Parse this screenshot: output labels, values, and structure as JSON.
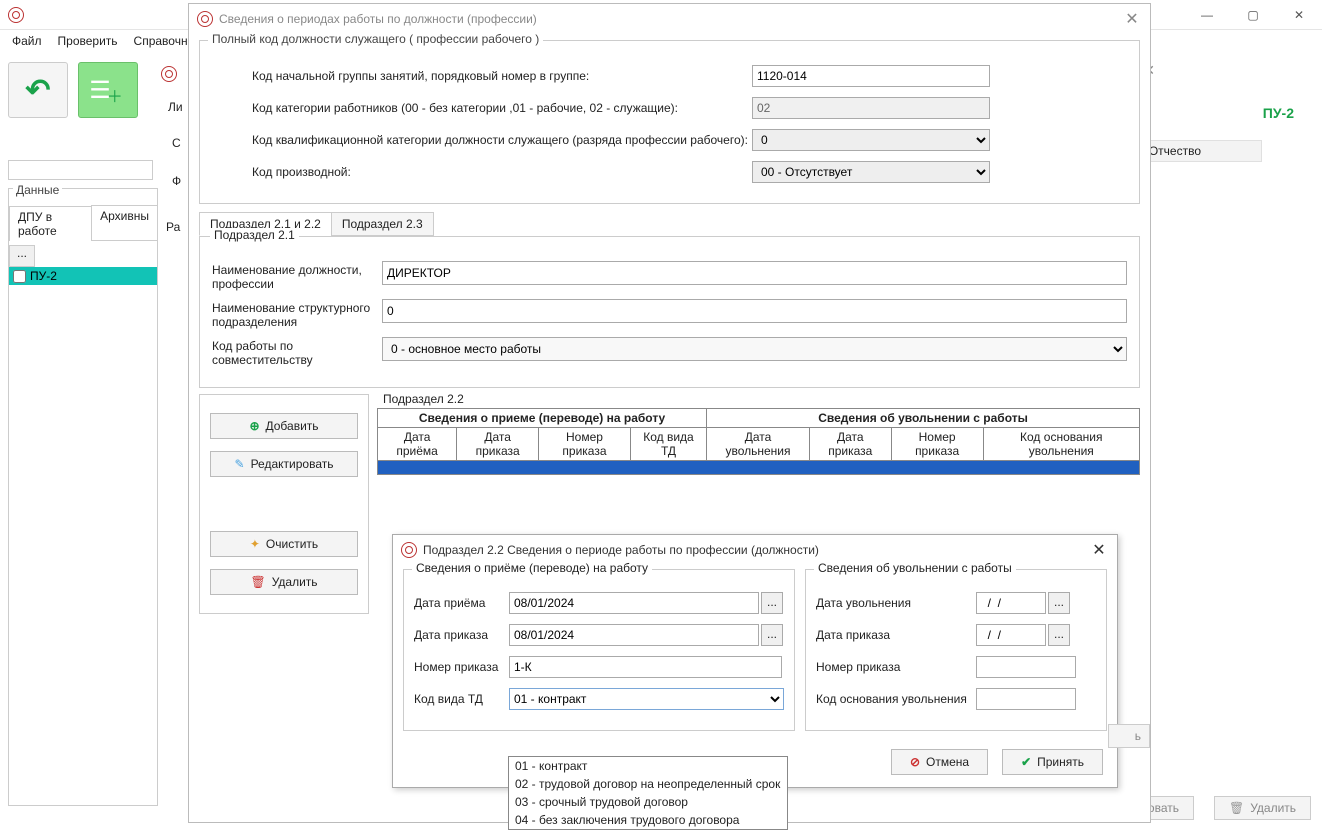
{
  "main": {
    "menu": {
      "file": "Файл",
      "check": "Проверить",
      "ref": "Справочни"
    },
    "pu2": "ПУ-2",
    "otchestvo": "Отчество",
    "data_label": "Данные",
    "tabs": {
      "active": "ДПУ в работе",
      "other": "Архивны"
    },
    "list_item": "ПУ-2",
    "bottom": {
      "edit": "тировать",
      "delete": "Удалить"
    }
  },
  "dlg1": {
    "title": "Сведения о периодах работы по должности (профессии)",
    "group_legend": "Полный код должности служащего ( профессии рабочего )",
    "rows": {
      "r1": {
        "label": "Код начальной группы занятий, порядковый номер в группе:",
        "value": "1120-014"
      },
      "r2": {
        "label": "Код категории работников (00 - без категории ,01 - рабочие, 02 - служащие):",
        "value": "02"
      },
      "r3": {
        "label": "Код квалификационной категории должности служащего (разряда профессии рабочего):",
        "value": "0"
      },
      "r4": {
        "label": "Код производной:",
        "value": "00 - Отсутствует"
      }
    },
    "tabs": {
      "t1": "Подраздел 2.1 и 2.2",
      "t2": "Подраздел 2.3"
    },
    "sub21": {
      "legend": "Подраздел 2.1",
      "r1": {
        "label": "Наименование должности, профессии",
        "value": "ДИРЕКТОР"
      },
      "r2": {
        "label": "Наименование структурного подразделения",
        "value": "0"
      },
      "r3": {
        "label": "Код работы по совместительству",
        "value": "0 - основное место работы"
      }
    },
    "actions": {
      "add": "Добавить",
      "edit": "Редактировать",
      "clear": "Очистить",
      "delete": "Удалить"
    },
    "sub22": {
      "legend": "Подраздел 2.2",
      "h_left": "Сведения о приеме (переводе) на работу",
      "h_right": "Сведения об увольнении с работы",
      "cols": {
        "c1": "Дата приёма",
        "c2": "Дата приказа",
        "c3": "Номер приказа",
        "c4": "Код вида ТД",
        "c5": "Дата увольнения",
        "c6": "Дата приказа",
        "c7": "Номер приказа",
        "c8": "Код основания увольнения"
      }
    }
  },
  "dlg2": {
    "title": "Подраздел 2.2 Сведения о периоде работы по профессии (должности)",
    "left_legend": "Сведения о приёме (переводе) на работу",
    "right_legend": "Сведения об увольнении с работы",
    "left": {
      "date_in": {
        "label": "Дата приёма",
        "value": "08/01/2024"
      },
      "date_ord": {
        "label": "Дата приказа",
        "value": "08/01/2024"
      },
      "num_ord": {
        "label": "Номер приказа",
        "value": "1-К"
      },
      "td_code": {
        "label": "Код вида ТД",
        "value": "01 - контракт"
      }
    },
    "right": {
      "date_out": {
        "label": "Дата увольнения",
        "value": "  /  /"
      },
      "date_ord": {
        "label": "Дата приказа",
        "value": "  /  /"
      },
      "num_ord": {
        "label": "Номер приказа",
        "value": ""
      },
      "basis": {
        "label": "Код основания увольнения",
        "value": ""
      }
    },
    "buttons": {
      "cancel": "Отмена",
      "ok": "Принять"
    },
    "dropdown": [
      "01 - контракт",
      "02 - трудовой договор на неопределенный срок",
      "03 - срочный трудовой договор",
      "04 - без заключения трудового договора"
    ]
  },
  "sec": {
    "letters": [
      "Ли",
      "С",
      "Ф",
      "Ра"
    ]
  }
}
